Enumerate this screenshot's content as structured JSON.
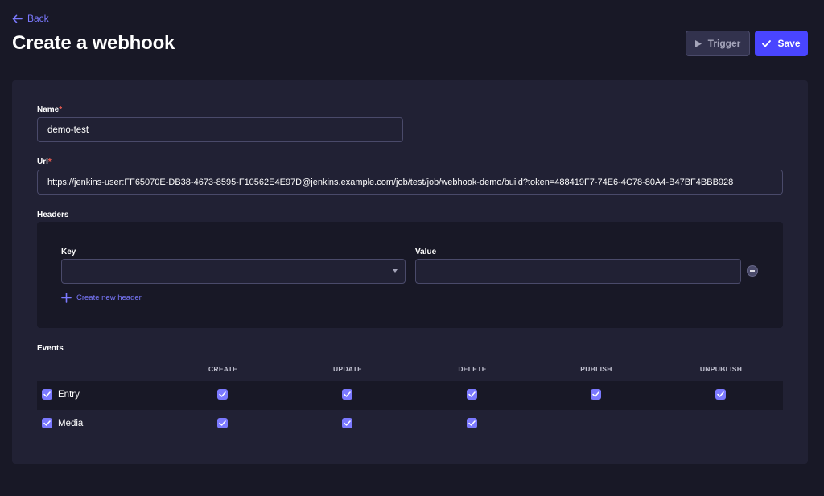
{
  "header": {
    "back_label": "Back",
    "title": "Create a webhook",
    "trigger_label": "Trigger",
    "save_label": "Save"
  },
  "form": {
    "name_label": "Name",
    "name_value": "demo-test",
    "url_label": "Url",
    "url_value": "https://jenkins-user:FF65070E-DB38-4673-8595-F10562E4E97D@jenkins.example.com/job/test/job/webhook-demo/build?token=488419F7-74E6-4C78-80A4-B47BF4BBB928",
    "required_mark": "*",
    "headers_label": "Headers",
    "headers": {
      "key_label": "Key",
      "value_label": "Value",
      "key_value": "",
      "value_value": "",
      "create_label": "Create new header"
    },
    "events": {
      "label": "Events",
      "columns": [
        "CREATE",
        "UPDATE",
        "DELETE",
        "PUBLISH",
        "UNPUBLISH"
      ],
      "rows": [
        {
          "label": "Entry",
          "checked": true,
          "events": [
            true,
            true,
            true,
            true,
            true
          ]
        },
        {
          "label": "Media",
          "checked": true,
          "events": [
            true,
            true,
            true,
            null,
            null
          ]
        }
      ]
    }
  },
  "colors": {
    "background": "#181826",
    "card": "#212134",
    "primary": "#4945ff",
    "accent": "#7b79ff",
    "required": "#ee5e52"
  },
  "icons": {
    "back": "arrow-left-icon",
    "trigger": "play-icon",
    "save": "check-icon",
    "add": "plus-icon",
    "remove": "minus-circle-icon",
    "dropdown": "caret-down-icon",
    "checkbox": "check-icon"
  }
}
